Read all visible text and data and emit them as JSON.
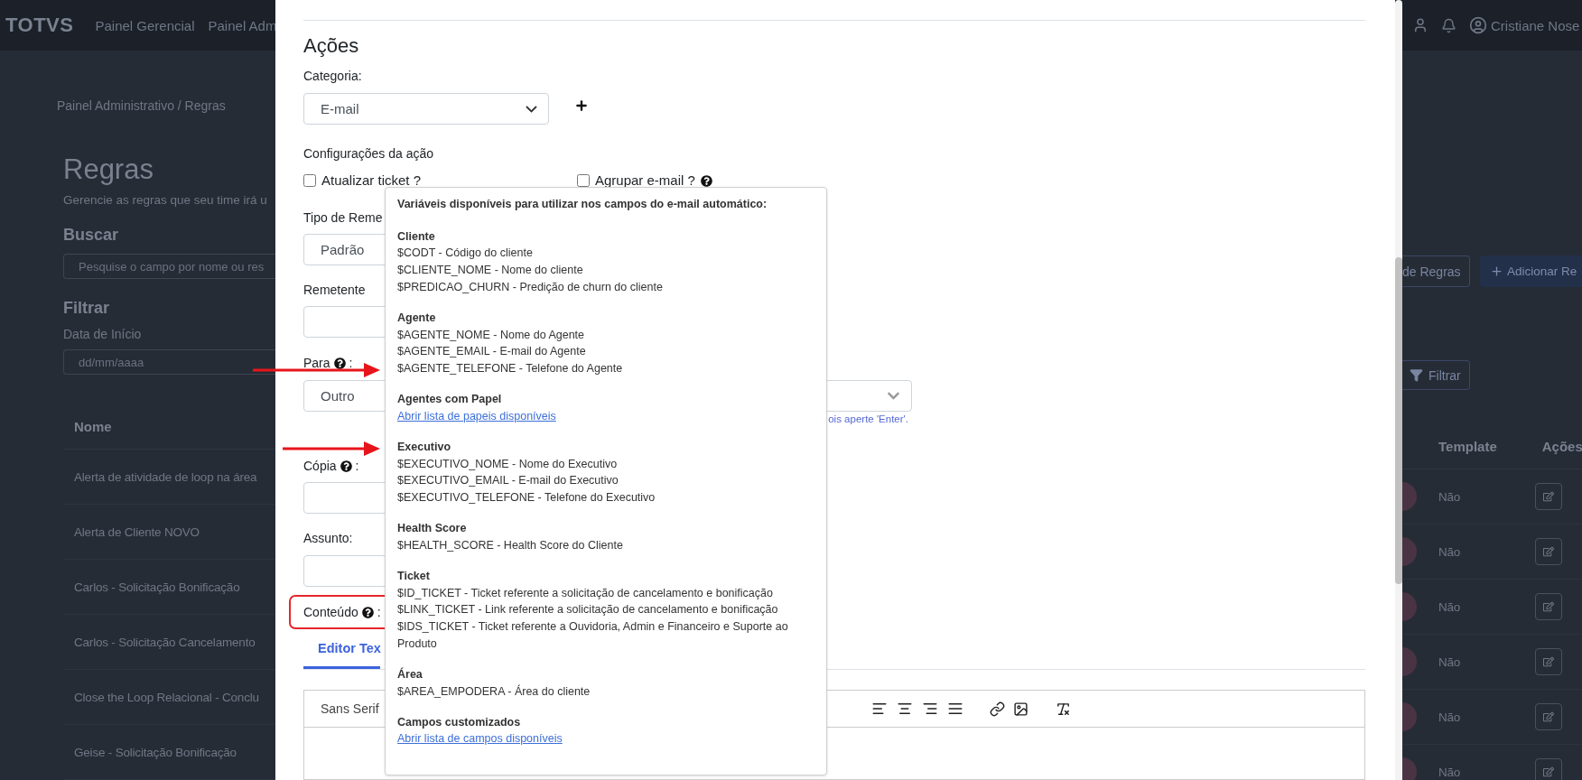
{
  "background_page": {
    "header": {
      "logo": "TOTVS",
      "nav": [
        "Painel Gerencial",
        "Painel Adm"
      ],
      "user_name": "Cristiane Nose"
    },
    "breadcrumb": "Painel Administrativo / Regras",
    "title": "Regras",
    "subtitle": "Gerencie as regras que seu time irá u",
    "search": {
      "label": "Buscar",
      "placeholder": "Pesquise o campo por nome ou res"
    },
    "filter": {
      "label": "Filtrar",
      "date_label": "Data de Início",
      "date_placeholder": "dd/mm/aaaa",
      "button": "Filtrar"
    },
    "buttons": [
      {
        "label": "de Regras",
        "kind": "outline"
      },
      {
        "label": "Adicionar Re",
        "kind": "primary"
      }
    ],
    "table": {
      "columns": [
        "Nome",
        "Template",
        "Ações"
      ],
      "rows": [
        {
          "name": "Alerta de atividade de loop na área",
          "template": "Não"
        },
        {
          "name": "Alerta de Cliente NOVO",
          "template": "Não"
        },
        {
          "name": "Carlos - Solicitação Bonificação",
          "template": "Não"
        },
        {
          "name": "Carlos - Solicitação Cancelamento",
          "template": "Não"
        },
        {
          "name": "Close the Loop Relacional - Conclu",
          "template": "Não"
        },
        {
          "name": "Geise - Solicitação Bonificação",
          "template": "Não"
        }
      ]
    }
  },
  "modal": {
    "section_title": "Ações",
    "category": {
      "label": "Categoria:",
      "value": "E-mail"
    },
    "config_title": "Configurações da ação",
    "checkboxes": [
      {
        "label": "Atualizar ticket ?",
        "checked": false,
        "help": false
      },
      {
        "label": "Agrupar e-mail ?",
        "checked": false,
        "help": true
      }
    ],
    "sender_type": {
      "label": "Tipo de Reme",
      "value": "Padrão"
    },
    "sender": {
      "label": "Remetente"
    },
    "to": {
      "label": "Para",
      "suffix": ":",
      "value": "Outro",
      "hint": "ois aperte 'Enter'."
    },
    "cc": {
      "label": "Cópia",
      "suffix": ":"
    },
    "subject": {
      "label": "Assunto:"
    },
    "content": {
      "label": "Conteúdo",
      "suffix": ":",
      "highlighted": true
    },
    "editor_tabs": [
      {
        "label": "Editor Tex",
        "selected": true
      }
    ],
    "editor": {
      "font": "Sans Serif"
    },
    "variables_popover": {
      "title": "Variáveis disponíveis para utilizar nos campos do e-mail automático:",
      "sections": [
        {
          "title": "Cliente",
          "kind": "variables",
          "items": [
            "$CODT - Código do cliente",
            "$CLIENTE_NOME - Nome do cliente",
            "$PREDICAO_CHURN - Predição de churn do cliente"
          ]
        },
        {
          "title": "Agente",
          "kind": "variables",
          "items": [
            "$AGENTE_NOME - Nome do Agente",
            "$AGENTE_EMAIL - E-mail do Agente",
            "$AGENTE_TELEFONE - Telefone do Agente"
          ]
        },
        {
          "title": "Agentes com Papel",
          "kind": "link",
          "link": "Abrir lista de papeis disponíveis"
        },
        {
          "title": "Executivo",
          "kind": "variables",
          "items": [
            "$EXECUTIVO_NOME - Nome do Executivo",
            "$EXECUTIVO_EMAIL - E-mail do Executivo",
            "$EXECUTIVO_TELEFONE - Telefone do Executivo"
          ]
        },
        {
          "title": "Health Score",
          "kind": "variables",
          "items": [
            "$HEALTH_SCORE - Health Score do Cliente"
          ]
        },
        {
          "title": "Ticket",
          "kind": "variables",
          "items": [
            "$ID_TICKET - Ticket referente a solicitação de cancelamento e bonificação",
            "$LINK_TICKET - Link referente a solicitação de cancelamento e bonificação",
            "$IDS_TICKET - Ticket referente a Ouvidoria, Admin e Financeiro e Suporte ao Produto"
          ]
        },
        {
          "title": "Área",
          "kind": "variables",
          "items": [
            "$AREA_EMPODERA - Área do cliente"
          ]
        },
        {
          "title": "Campos customizados",
          "kind": "link",
          "link": "Abrir lista de campos disponíveis"
        }
      ]
    }
  }
}
